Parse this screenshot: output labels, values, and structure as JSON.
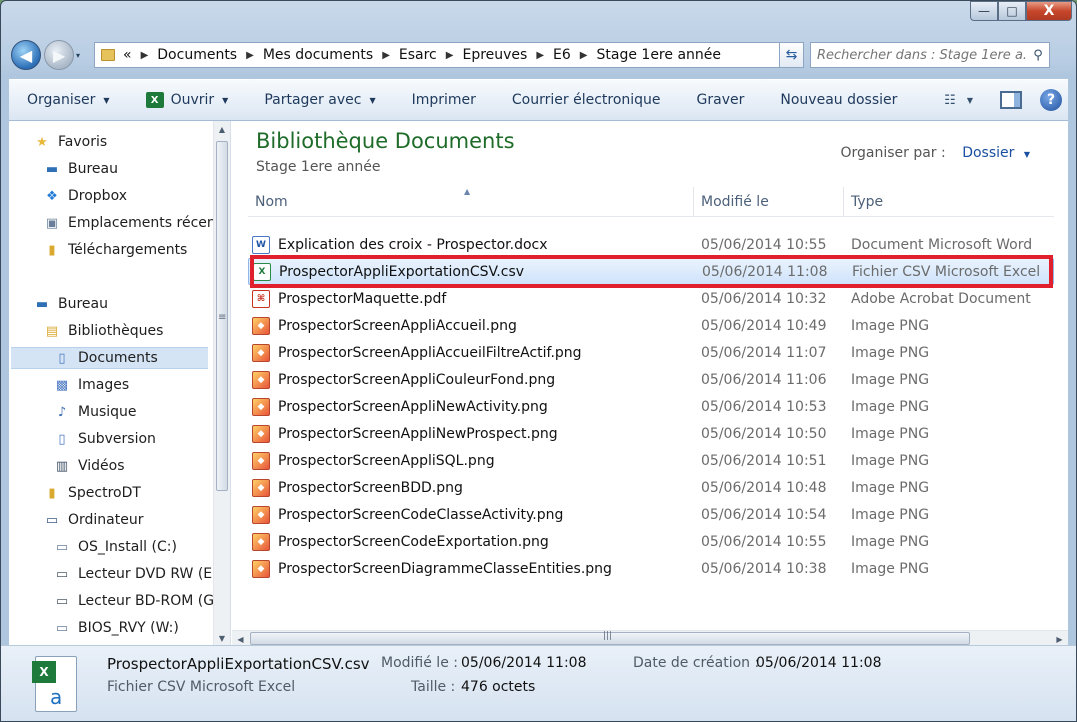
{
  "window": {
    "minimize": "—",
    "maximize": "□",
    "close": "X"
  },
  "nav": {
    "back": "◀",
    "forward": "▶",
    "dropdown": "▾"
  },
  "address": {
    "root": "«",
    "crumbs": [
      "Documents",
      "Mes documents",
      "Esarc",
      "Epreuves",
      "E6",
      "Stage 1ere année"
    ],
    "separator": "▶",
    "refresh": "⇆"
  },
  "search": {
    "placeholder": "Rechercher dans : Stage 1ere a...",
    "icon": "search-icon"
  },
  "toolbar": {
    "organize": "Organiser",
    "open": "Ouvrir",
    "share": "Partager avec",
    "print": "Imprimer",
    "email": "Courrier électronique",
    "burn": "Graver",
    "new_folder": "Nouveau dossier",
    "help": "?"
  },
  "sidebar": {
    "items": [
      {
        "label": "Favoris",
        "icon": "star-icon"
      },
      {
        "label": "Bureau",
        "icon": "desktop-icon"
      },
      {
        "label": "Dropbox",
        "icon": "dropbox-icon"
      },
      {
        "label": "Emplacements récents",
        "icon": "recent-places-icon"
      },
      {
        "label": "Téléchargements",
        "icon": "downloads-icon"
      },
      {
        "label": "Bureau",
        "icon": "desktop-icon"
      },
      {
        "label": "Bibliothèques",
        "icon": "libraries-icon"
      },
      {
        "label": "Documents",
        "icon": "documents-icon"
      },
      {
        "label": "Images",
        "icon": "images-icon"
      },
      {
        "label": "Musique",
        "icon": "music-icon"
      },
      {
        "label": "Subversion",
        "icon": "subversion-icon"
      },
      {
        "label": "Vidéos",
        "icon": "videos-icon"
      },
      {
        "label": "SpectroDT",
        "icon": "folder-icon"
      },
      {
        "label": "Ordinateur",
        "icon": "computer-icon"
      },
      {
        "label": "OS_Install (C:)",
        "icon": "drive-icon"
      },
      {
        "label": "Lecteur DVD RW (E:",
        "icon": "dvd-drive-icon"
      },
      {
        "label": "Lecteur BD-ROM (G",
        "icon": "bd-drive-icon"
      },
      {
        "label": "BIOS_RVY (W:)",
        "icon": "drive-icon"
      }
    ]
  },
  "library": {
    "title": "Bibliothèque Documents",
    "subtitle": "Stage 1ere année",
    "arrange_label": "Organiser par :",
    "arrange_value": "Dossier"
  },
  "columns": {
    "name": "Nom",
    "modified": "Modifié le",
    "type": "Type"
  },
  "files": [
    {
      "name": "Explication des croix - Prospector.docx",
      "modified": "05/06/2014 10:55",
      "type": "Document Microsoft Word",
      "icon": "word"
    },
    {
      "name": "ProspectorAppliExportationCSV.csv",
      "modified": "05/06/2014 11:08",
      "type": "Fichier CSV Microsoft Excel",
      "icon": "csv"
    },
    {
      "name": "ProspectorMaquette.pdf",
      "modified": "05/06/2014 10:32",
      "type": "Adobe Acrobat Document",
      "icon": "pdf"
    },
    {
      "name": "ProspectorScreenAppliAccueil.png",
      "modified": "05/06/2014 10:49",
      "type": "Image PNG",
      "icon": "png"
    },
    {
      "name": "ProspectorScreenAppliAccueilFiltreActif.png",
      "modified": "05/06/2014 11:07",
      "type": "Image PNG",
      "icon": "png"
    },
    {
      "name": "ProspectorScreenAppliCouleurFond.png",
      "modified": "05/06/2014 11:06",
      "type": "Image PNG",
      "icon": "png"
    },
    {
      "name": "ProspectorScreenAppliNewActivity.png",
      "modified": "05/06/2014 10:53",
      "type": "Image PNG",
      "icon": "png"
    },
    {
      "name": "ProspectorScreenAppliNewProspect.png",
      "modified": "05/06/2014 10:50",
      "type": "Image PNG",
      "icon": "png"
    },
    {
      "name": "ProspectorScreenAppliSQL.png",
      "modified": "05/06/2014 10:51",
      "type": "Image PNG",
      "icon": "png"
    },
    {
      "name": "ProspectorScreenBDD.png",
      "modified": "05/06/2014 10:48",
      "type": "Image PNG",
      "icon": "png"
    },
    {
      "name": "ProspectorScreenCodeClasseActivity.png",
      "modified": "05/06/2014 10:54",
      "type": "Image PNG",
      "icon": "png"
    },
    {
      "name": "ProspectorScreenCodeExportation.png",
      "modified": "05/06/2014 10:55",
      "type": "Image PNG",
      "icon": "png"
    },
    {
      "name": "ProspectorScreenDiagrammeClasseEntities.png",
      "modified": "05/06/2014 10:38",
      "type": "Image PNG",
      "icon": "png"
    }
  ],
  "selected_index": 1,
  "details": {
    "name": "ProspectorAppliExportationCSV.csv",
    "type": "Fichier CSV Microsoft Excel",
    "modified_label": "Modifié le :",
    "modified_value": "05/06/2014 11:08",
    "created_label": "Date de création :",
    "created_value": "05/06/2014 11:08",
    "size_label": "Taille :",
    "size_value": "476 octets"
  },
  "colors": {
    "library_title": "#1f6c2a",
    "highlight_box": "#e0202c",
    "selection": "#cfe3fb"
  }
}
